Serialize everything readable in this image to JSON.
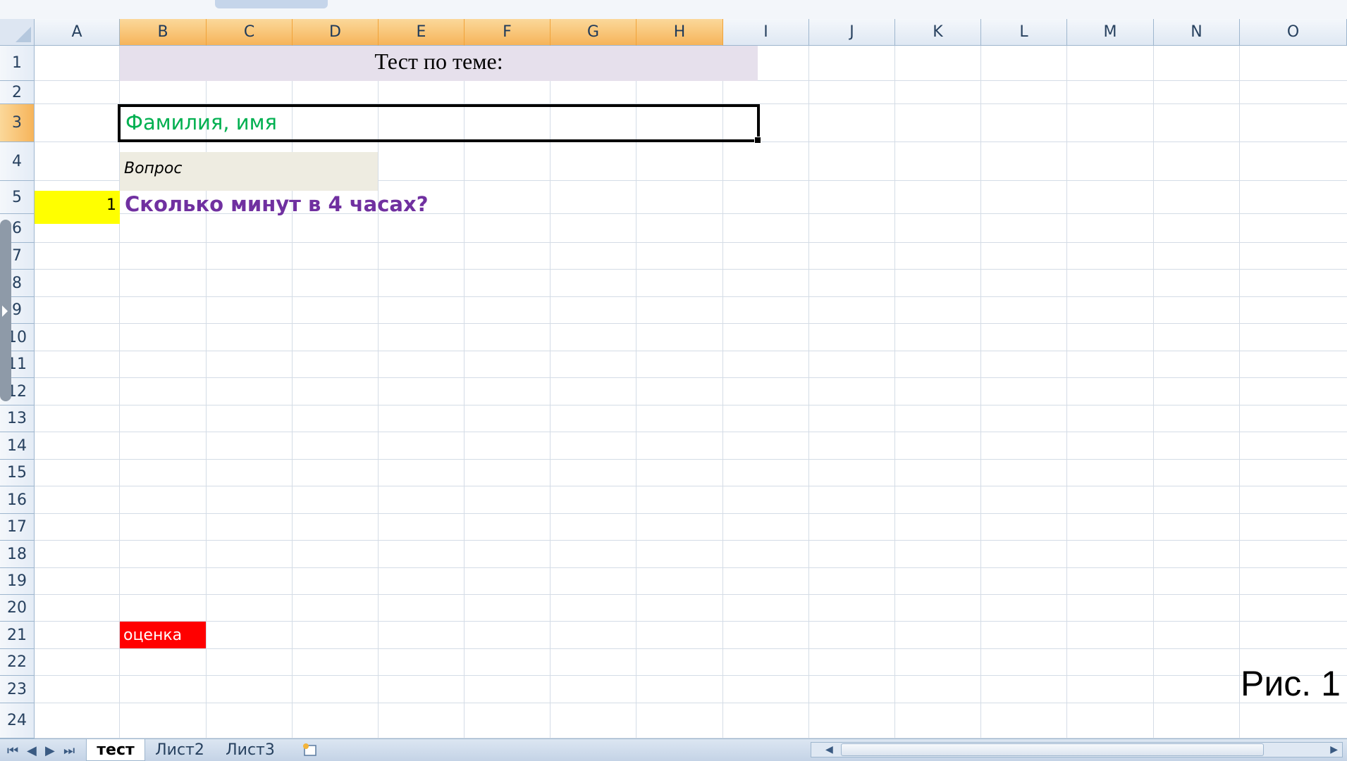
{
  "columns": [
    "A",
    "B",
    "C",
    "D",
    "E",
    "F",
    "G",
    "H",
    "I",
    "J",
    "K",
    "L",
    "M",
    "N",
    "O"
  ],
  "rows": [
    "1",
    "2",
    "3",
    "4",
    "5",
    "6",
    "7",
    "8",
    "9",
    "10",
    "11",
    "12",
    "13",
    "14",
    "15",
    "16",
    "17",
    "18",
    "19",
    "20",
    "21",
    "22",
    "23",
    "24"
  ],
  "selected_columns": [
    "B",
    "C",
    "D",
    "E",
    "F",
    "G",
    "H"
  ],
  "selected_row": "3",
  "cells": {
    "title": "Тест по теме:",
    "name_field": "Фамилия, имя",
    "question_header": "Вопрос",
    "question_number": "1",
    "question_text": "Сколько минут в 4 часах?",
    "grade_label": "оценка"
  },
  "colors": {
    "title_fill": "#e6e0ec",
    "question_header_fill": "#eeece1",
    "number_fill": "#ffff00",
    "grade_fill": "#ff0000",
    "name_text": "#00b050",
    "question_text": "#7030a0",
    "header_selected": "#f6b45a"
  },
  "sheet_tabs": [
    {
      "label": "тест",
      "active": true
    },
    {
      "label": "Лист2",
      "active": false
    },
    {
      "label": "Лист3",
      "active": false
    }
  ],
  "icons": {
    "insert_sheet": "insert-sheet-icon",
    "nav_first": "⏮",
    "nav_prev": "◀",
    "nav_next": "▶",
    "nav_last": "⏭"
  },
  "caption": "Рис. 1"
}
